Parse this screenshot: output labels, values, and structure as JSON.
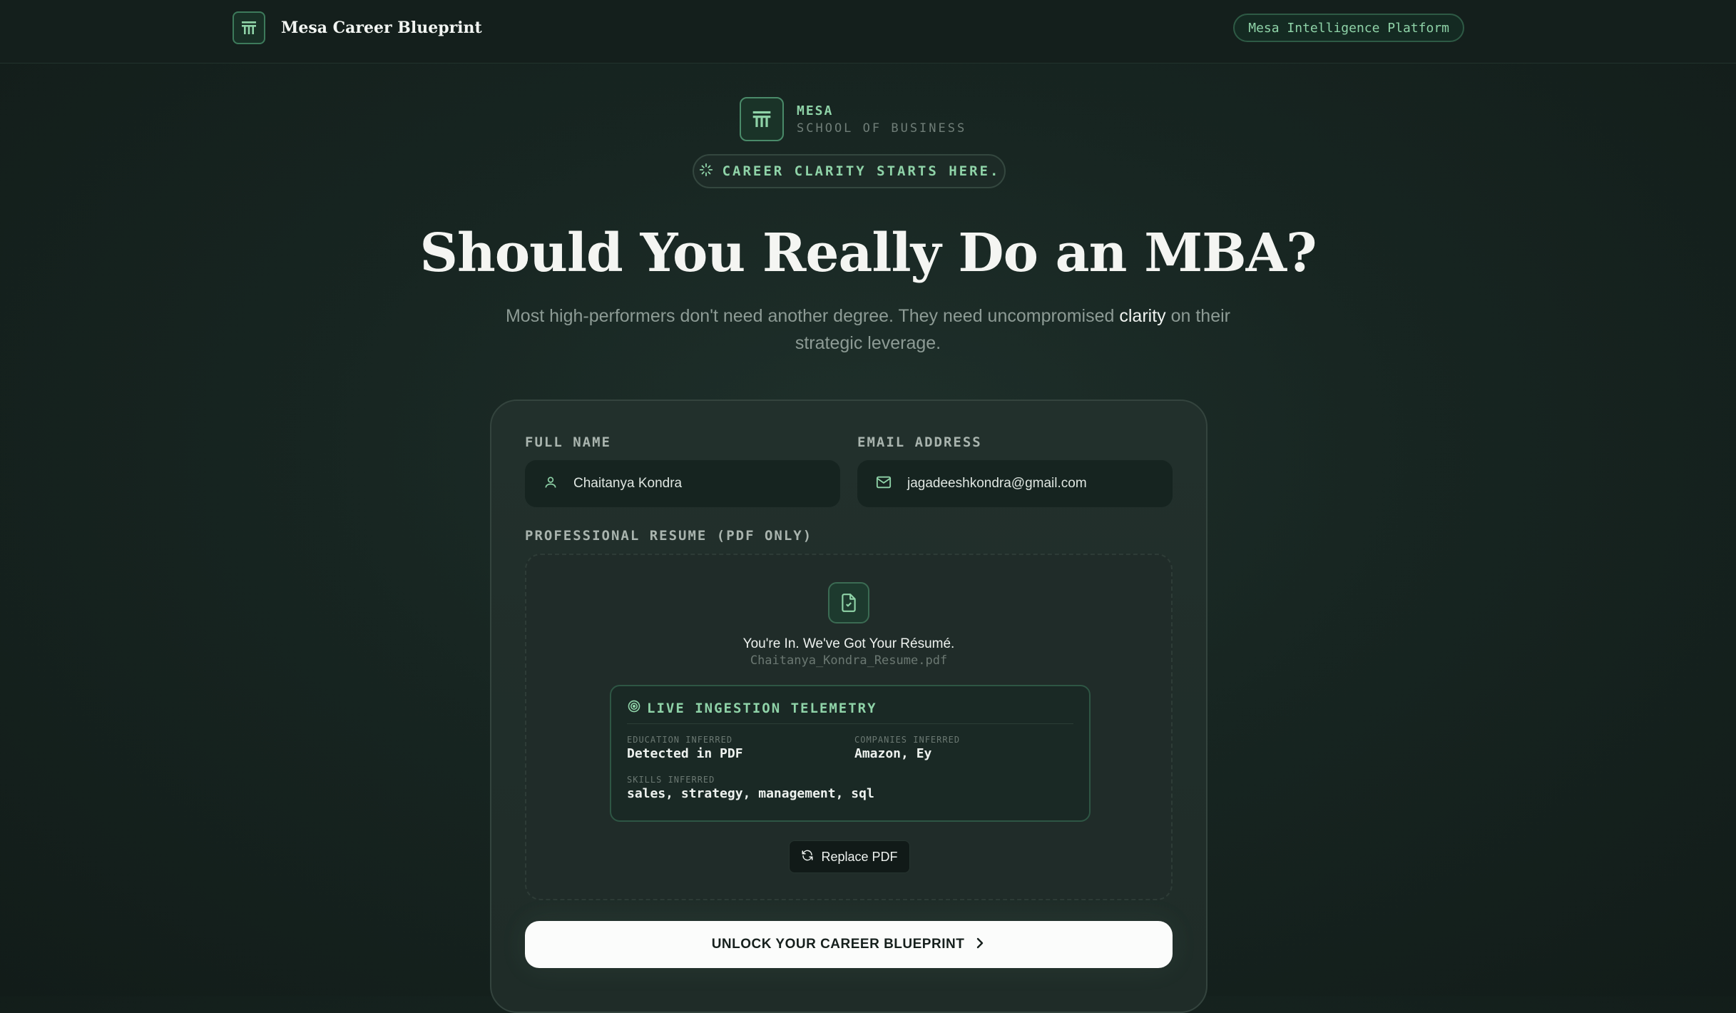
{
  "nav": {
    "brand_name": "Mesa Career Blueprint",
    "platform_badge": "Mesa Intelligence Platform"
  },
  "school": {
    "name": "MESA",
    "tagline": "SCHOOL OF BUSINESS"
  },
  "hero": {
    "pill": "CAREER CLARITY STARTS HERE.",
    "title": "Should You Really Do an MBA?",
    "subtitle_before": "Most high-performers don't need another degree. They need uncompromised ",
    "subtitle_highlight": "clarity",
    "subtitle_after": " on their strategic leverage."
  },
  "form": {
    "full_name_label": "FULL NAME",
    "full_name_value": "Chaitanya Kondra",
    "email_label": "EMAIL ADDRESS",
    "email_value": "jagadeeshkondra@gmail.com",
    "resume_label": "PROFESSIONAL RESUME (PDF ONLY)"
  },
  "upload": {
    "status": "You're In. We've Got Your Résumé.",
    "file_name": "Chaitanya_Kondra_Resume.pdf",
    "replace_label": "Replace PDF"
  },
  "telemetry": {
    "title": "LIVE INGESTION TELEMETRY",
    "education_key": "EDUCATION INFERRED",
    "education_value": "Detected in PDF",
    "companies_key": "COMPANIES INFERRED",
    "companies_value": "Amazon, Ey",
    "skills_key": "SKILLS INFERRED",
    "skills_value": "sales, strategy, management, sql"
  },
  "cta": {
    "label": "UNLOCK YOUR CAREER BLUEPRINT"
  },
  "colors": {
    "accent_green": "#8fd3a8",
    "background": "#172521",
    "card": "#22302c"
  }
}
